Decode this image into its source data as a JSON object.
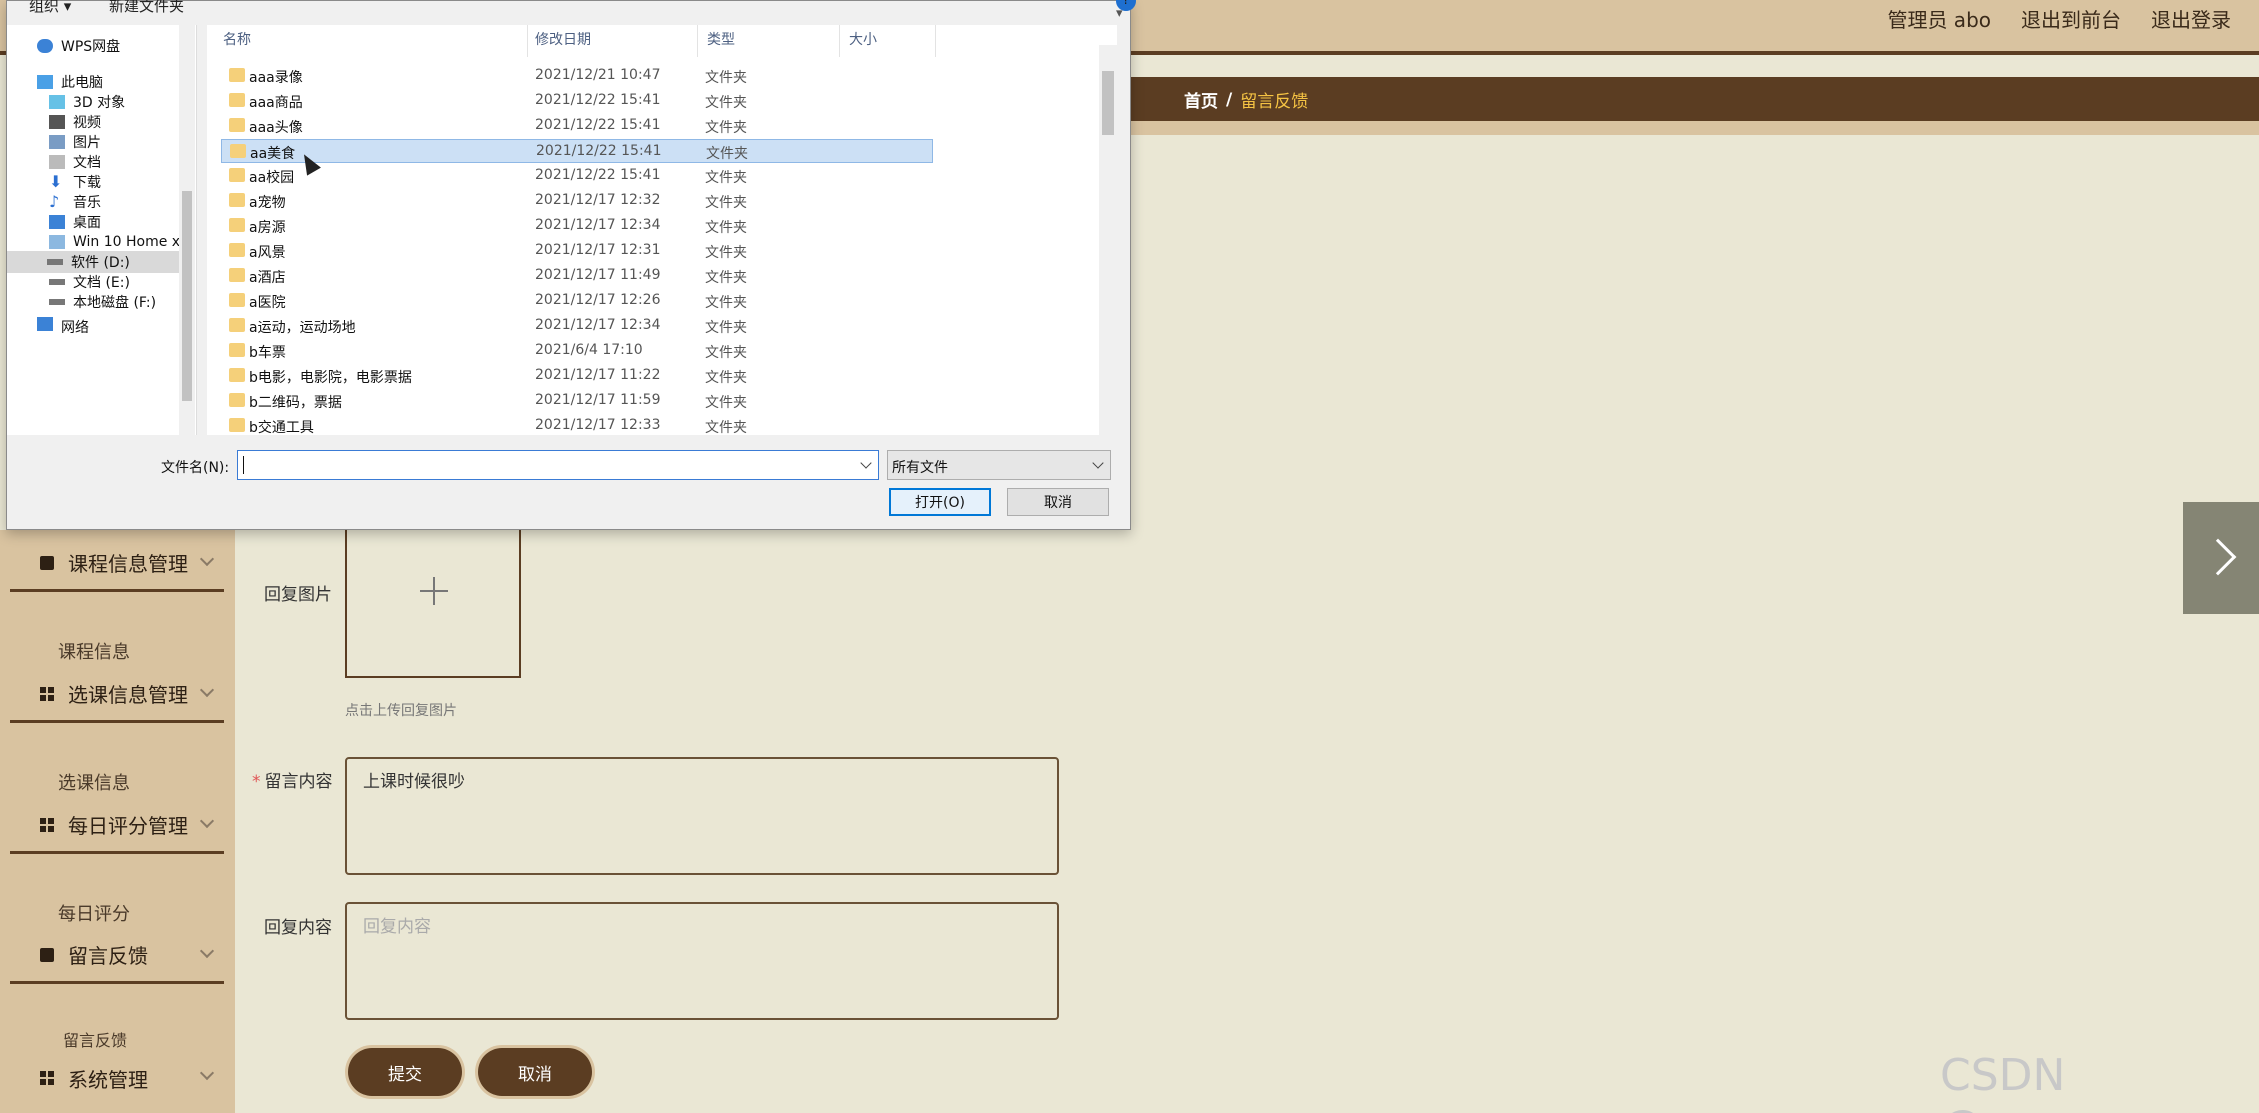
{
  "header": {
    "admin_label": "管理员 abo",
    "front_link": "退出到前台",
    "logout_link": "退出登录"
  },
  "breadcrumb": {
    "home": "首页",
    "separator": "/",
    "current": "留言反馈"
  },
  "sidebar": {
    "groups": [
      {
        "label": "课程信息管理",
        "sub": "课程信息"
      },
      {
        "label": "选课信息管理",
        "sub": "选课信息"
      },
      {
        "label": "每日评分管理",
        "sub": "每日评分"
      },
      {
        "label": "留言反馈",
        "sub": "留言反馈"
      },
      {
        "label": "系统管理"
      }
    ]
  },
  "form": {
    "reply_image_label": "回复图片",
    "upload_hint": "点击上传回复图片",
    "content_label": "留言内容",
    "content_required": "*",
    "content_value": "上课时候很吵",
    "reply_label": "回复内容",
    "reply_placeholder": "回复内容",
    "submit_label": "提交",
    "cancel_label": "取消"
  },
  "watermark": "CSDN @cccc_cz",
  "dialog": {
    "toolbar": {
      "organize": "组织 ▾",
      "new_folder": "新建文件夹"
    },
    "nav": [
      "WPS网盘",
      "此电脑",
      "3D 对象",
      "视频",
      "图片",
      "文档",
      "下载",
      "音乐",
      "桌面",
      "Win 10 Home x",
      "软件 (D:)",
      "文档 (E:)",
      "本地磁盘 (F:)",
      "网络"
    ],
    "columns": {
      "name": "名称",
      "date": "修改日期",
      "type": "类型",
      "size": "大小"
    },
    "rows": [
      {
        "name": "aaa录像",
        "date": "2021/12/21 10:47",
        "type": "文件夹"
      },
      {
        "name": "aaa商品",
        "date": "2021/12/22 15:41",
        "type": "文件夹"
      },
      {
        "name": "aaa头像",
        "date": "2021/12/22 15:41",
        "type": "文件夹"
      },
      {
        "name": "aa美食",
        "date": "2021/12/22 15:41",
        "type": "文件夹"
      },
      {
        "name": "aa校园",
        "date": "2021/12/22 15:41",
        "type": "文件夹"
      },
      {
        "name": "a宠物",
        "date": "2021/12/17 12:32",
        "type": "文件夹"
      },
      {
        "name": "a房源",
        "date": "2021/12/17 12:34",
        "type": "文件夹"
      },
      {
        "name": "a风景",
        "date": "2021/12/17 12:31",
        "type": "文件夹"
      },
      {
        "name": "a酒店",
        "date": "2021/12/17 11:49",
        "type": "文件夹"
      },
      {
        "name": "a医院",
        "date": "2021/12/17 12:26",
        "type": "文件夹"
      },
      {
        "name": "a运动，运动场地",
        "date": "2021/12/17 12:34",
        "type": "文件夹"
      },
      {
        "name": "b车票",
        "date": "2021/6/4 17:10",
        "type": "文件夹"
      },
      {
        "name": "b电影，电影院，电影票据",
        "date": "2021/12/17 11:22",
        "type": "文件夹"
      },
      {
        "name": "b二维码，票据",
        "date": "2021/12/17 11:59",
        "type": "文件夹"
      },
      {
        "name": "b交通工具",
        "date": "2021/12/17 12:33",
        "type": "文件夹"
      }
    ],
    "selected_row": "aa美食",
    "filename_label": "文件名(N):",
    "filename_value": "",
    "filter_value": "所有文件",
    "open_button": "打开(O)",
    "cancel_button": "取消"
  }
}
